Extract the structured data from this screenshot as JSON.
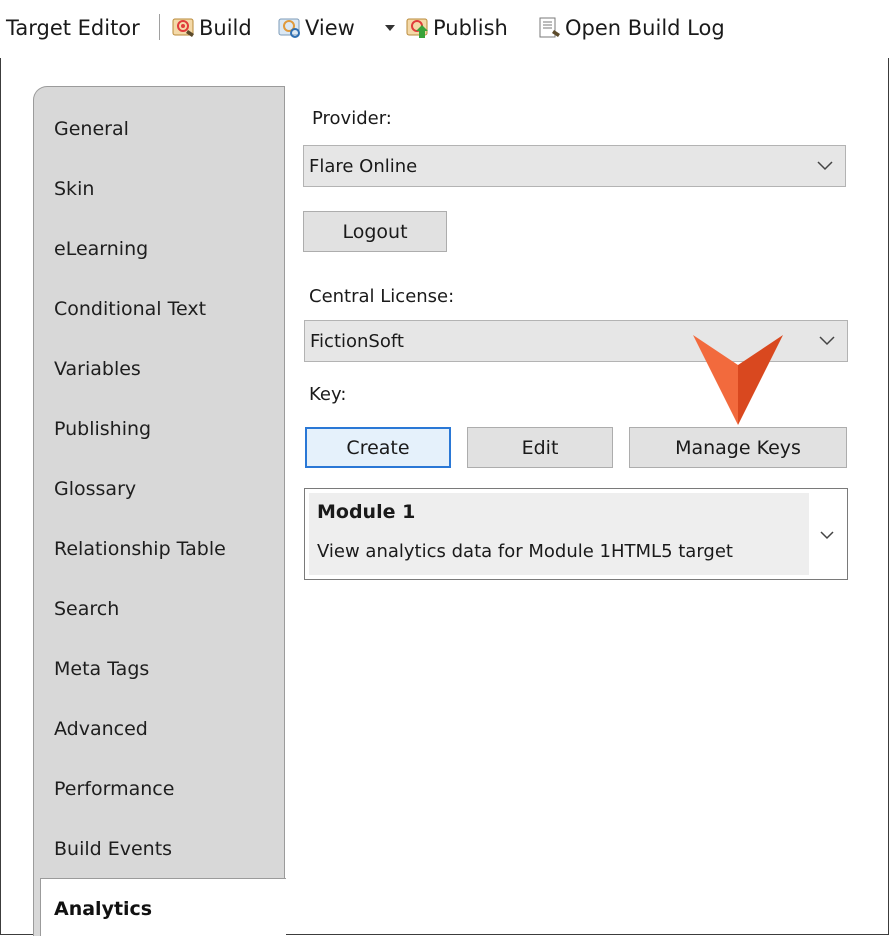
{
  "toolbar": {
    "title": "Target Editor",
    "build_label": "Build",
    "view_label": "View",
    "publish_label": "Publish",
    "open_build_log_label": "Open Build Log"
  },
  "tabs": [
    {
      "label": "General"
    },
    {
      "label": "Skin"
    },
    {
      "label": "eLearning"
    },
    {
      "label": "Conditional Text"
    },
    {
      "label": "Variables"
    },
    {
      "label": "Publishing"
    },
    {
      "label": "Glossary"
    },
    {
      "label": "Relationship Table"
    },
    {
      "label": "Search"
    },
    {
      "label": "Meta Tags"
    },
    {
      "label": "Advanced"
    },
    {
      "label": "Performance"
    },
    {
      "label": "Build Events"
    },
    {
      "label": "Analytics",
      "active": true
    }
  ],
  "form": {
    "provider_label": "Provider:",
    "provider_value": "Flare Online",
    "logout_label": "Logout",
    "central_license_label": "Central License:",
    "central_license_value": "FictionSoft",
    "key_label": "Key:",
    "create_label": "Create",
    "edit_label": "Edit",
    "manage_keys_label": "Manage Keys",
    "key_selected_title": "Module 1",
    "key_selected_desc": "View analytics data for Module 1HTML5 target"
  },
  "colors": {
    "accent": "#2a78d6",
    "pointer": "#e8502a",
    "tab_panel": "#d8d8d8"
  }
}
